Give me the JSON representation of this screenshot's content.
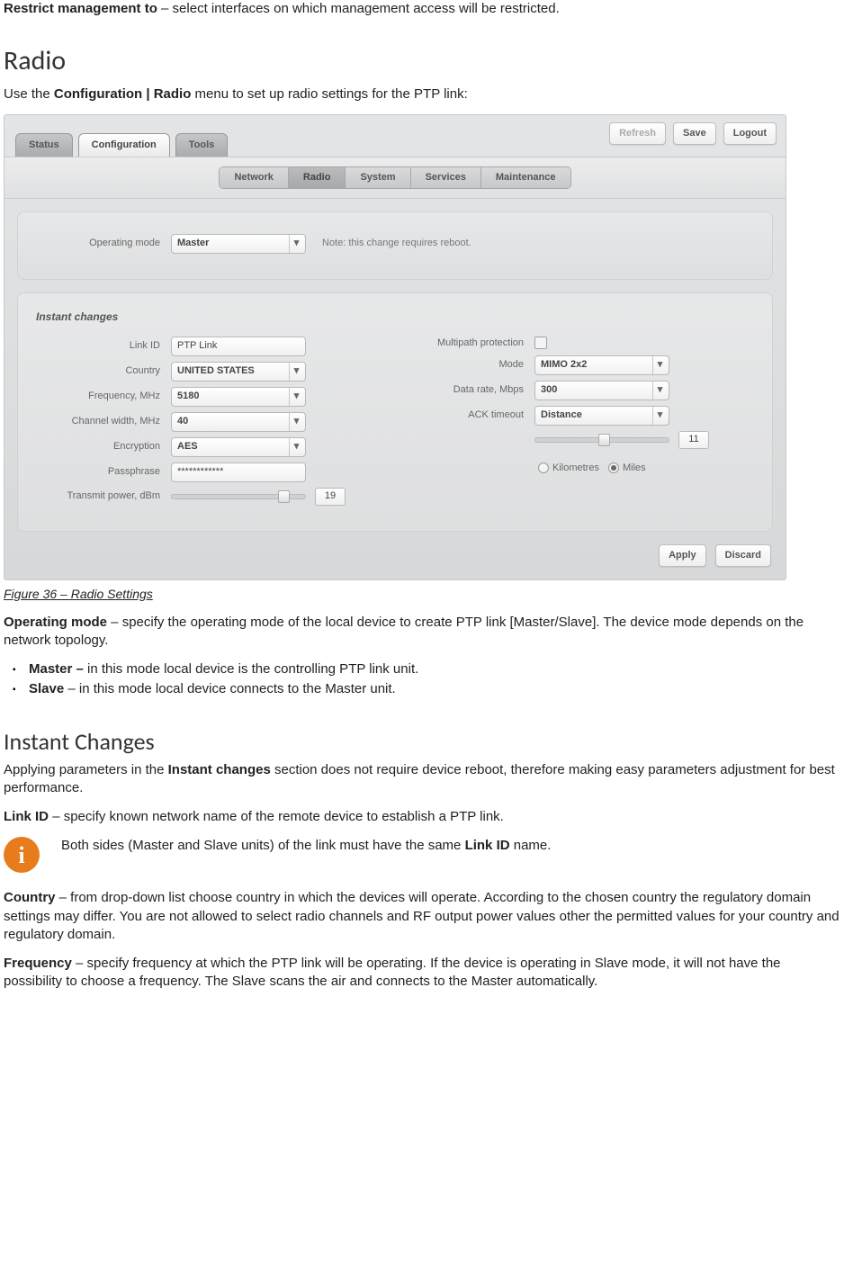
{
  "intro": {
    "restrict_label": "Restrict management to",
    "restrict_desc": " – select interfaces on which management access will be restricted."
  },
  "radio": {
    "heading": "Radio",
    "intro_pre": "Use the ",
    "intro_bold": "Configuration | Radio",
    "intro_post": " menu to set up radio settings for the PTP link:",
    "caption": "Figure 36 – Radio Settings",
    "opmode_label": "Operating mode",
    "opmode_desc": " – specify the operating mode of the local device to create PTP link [Master/Slave]. The device mode depends on the network topology.",
    "master_label": "Master –",
    "master_desc": " in this mode local device is the controlling PTP link unit.",
    "slave_label": "Slave",
    "slave_desc": " – in this mode local device connects to the Master unit."
  },
  "instant": {
    "heading": "Instant Changes",
    "para1_pre": "Applying parameters in the ",
    "para1_bold": "Instant changes",
    "para1_post": " section does not require device reboot, therefore making easy parameters adjustment for best performance.",
    "linkid_label": "Link ID",
    "linkid_desc": " – specify known network name of the remote device to establish a PTP link.",
    "info_pre": "Both sides (Master and Slave units) of the link must have the same ",
    "info_bold": "Link ID",
    "info_post": " name.",
    "country_label": "Country",
    "country_desc": " – from drop-down list choose country in which the devices will operate. According to the chosen country the regulatory domain settings may differ. You are not allowed to select radio channels and RF output power values other the permitted values for your country and regulatory domain.",
    "freq_label": "Frequency",
    "freq_desc": " – specify frequency at which the PTP link will be operating. If the device is operating in Slave mode, it will not have the possibility to choose a frequency. The Slave scans the air and connects to the Master automatically."
  },
  "ui": {
    "top_buttons": {
      "refresh": "Refresh",
      "save": "Save",
      "logout": "Logout"
    },
    "main_tabs": {
      "status": "Status",
      "configuration": "Configuration",
      "tools": "Tools"
    },
    "sub_tabs": {
      "network": "Network",
      "radio": "Radio",
      "system": "System",
      "services": "Services",
      "maintenance": "Maintenance"
    },
    "op_panel": {
      "label": "Operating mode",
      "value": "Master",
      "note": "Note: this change requires reboot."
    },
    "instant_panel": {
      "title": "Instant changes",
      "left": {
        "linkid_label": "Link ID",
        "linkid_value": "PTP Link",
        "country_label": "Country",
        "country_value": "UNITED STATES",
        "freq_label": "Frequency, MHz",
        "freq_value": "5180",
        "chw_label": "Channel width, MHz",
        "chw_value": "40",
        "enc_label": "Encryption",
        "enc_value": "AES",
        "pass_label": "Passphrase",
        "pass_value": "************",
        "txp_label": "Transmit power, dBm",
        "txp_value": "19"
      },
      "right": {
        "mpp_label": "Multipath protection",
        "mode_label": "Mode",
        "mode_value": "MIMO 2x2",
        "dr_label": "Data rate, Mbps",
        "dr_value": "300",
        "ack_label": "ACK timeout",
        "ack_value": "Distance",
        "dist_value": "11",
        "unit_km": "Kilometres",
        "unit_mi": "Miles"
      }
    },
    "bottom_buttons": {
      "apply": "Apply",
      "discard": "Discard"
    }
  }
}
